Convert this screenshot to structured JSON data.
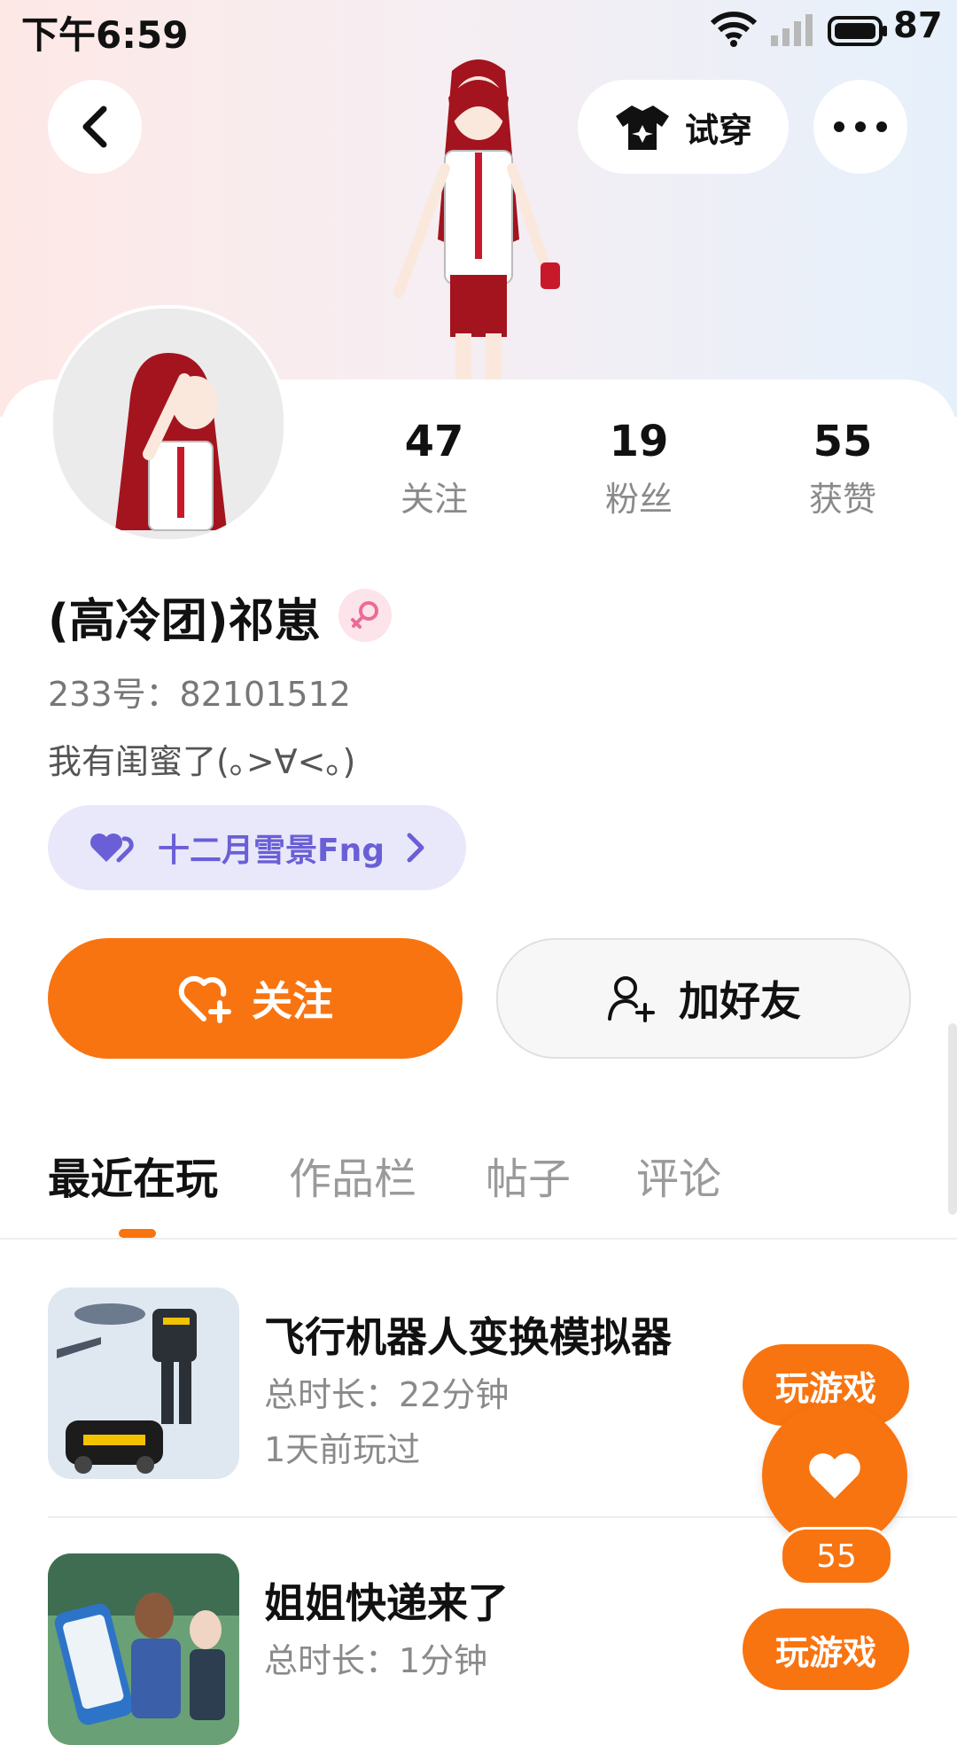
{
  "status_bar": {
    "time": "下午6:59",
    "battery": "87"
  },
  "header": {
    "try_on_label": "试穿"
  },
  "stats": [
    {
      "value": "47",
      "label": "关注"
    },
    {
      "value": "19",
      "label": "粉丝"
    },
    {
      "value": "55",
      "label": "获赞"
    }
  ],
  "profile": {
    "name": "(高冷团)祁崽",
    "id_text": "233号：82101512",
    "bio": "我有闺蜜了(｡>∀<｡)",
    "bestie": "十二月雪景Fng"
  },
  "actions": {
    "follow": "关注",
    "add_friend": "加好友"
  },
  "tabs": [
    {
      "label": "最近在玩",
      "active": true
    },
    {
      "label": "作品栏",
      "active": false
    },
    {
      "label": "帖子",
      "active": false
    },
    {
      "label": "评论",
      "active": false
    }
  ],
  "games": [
    {
      "title": "飞行机器人变换模拟器",
      "duration": "总时长：22分钟",
      "last_played": "1天前玩过",
      "play_label": "玩游戏"
    },
    {
      "title": "姐姐快递来了",
      "duration": "总时长：1分钟",
      "play_label": "玩游戏"
    }
  ],
  "like_fab": {
    "count": "55"
  },
  "colors": {
    "accent": "#f87410",
    "bestie_bg": "#e9e8fb",
    "bestie_text": "#6a5fd6"
  }
}
